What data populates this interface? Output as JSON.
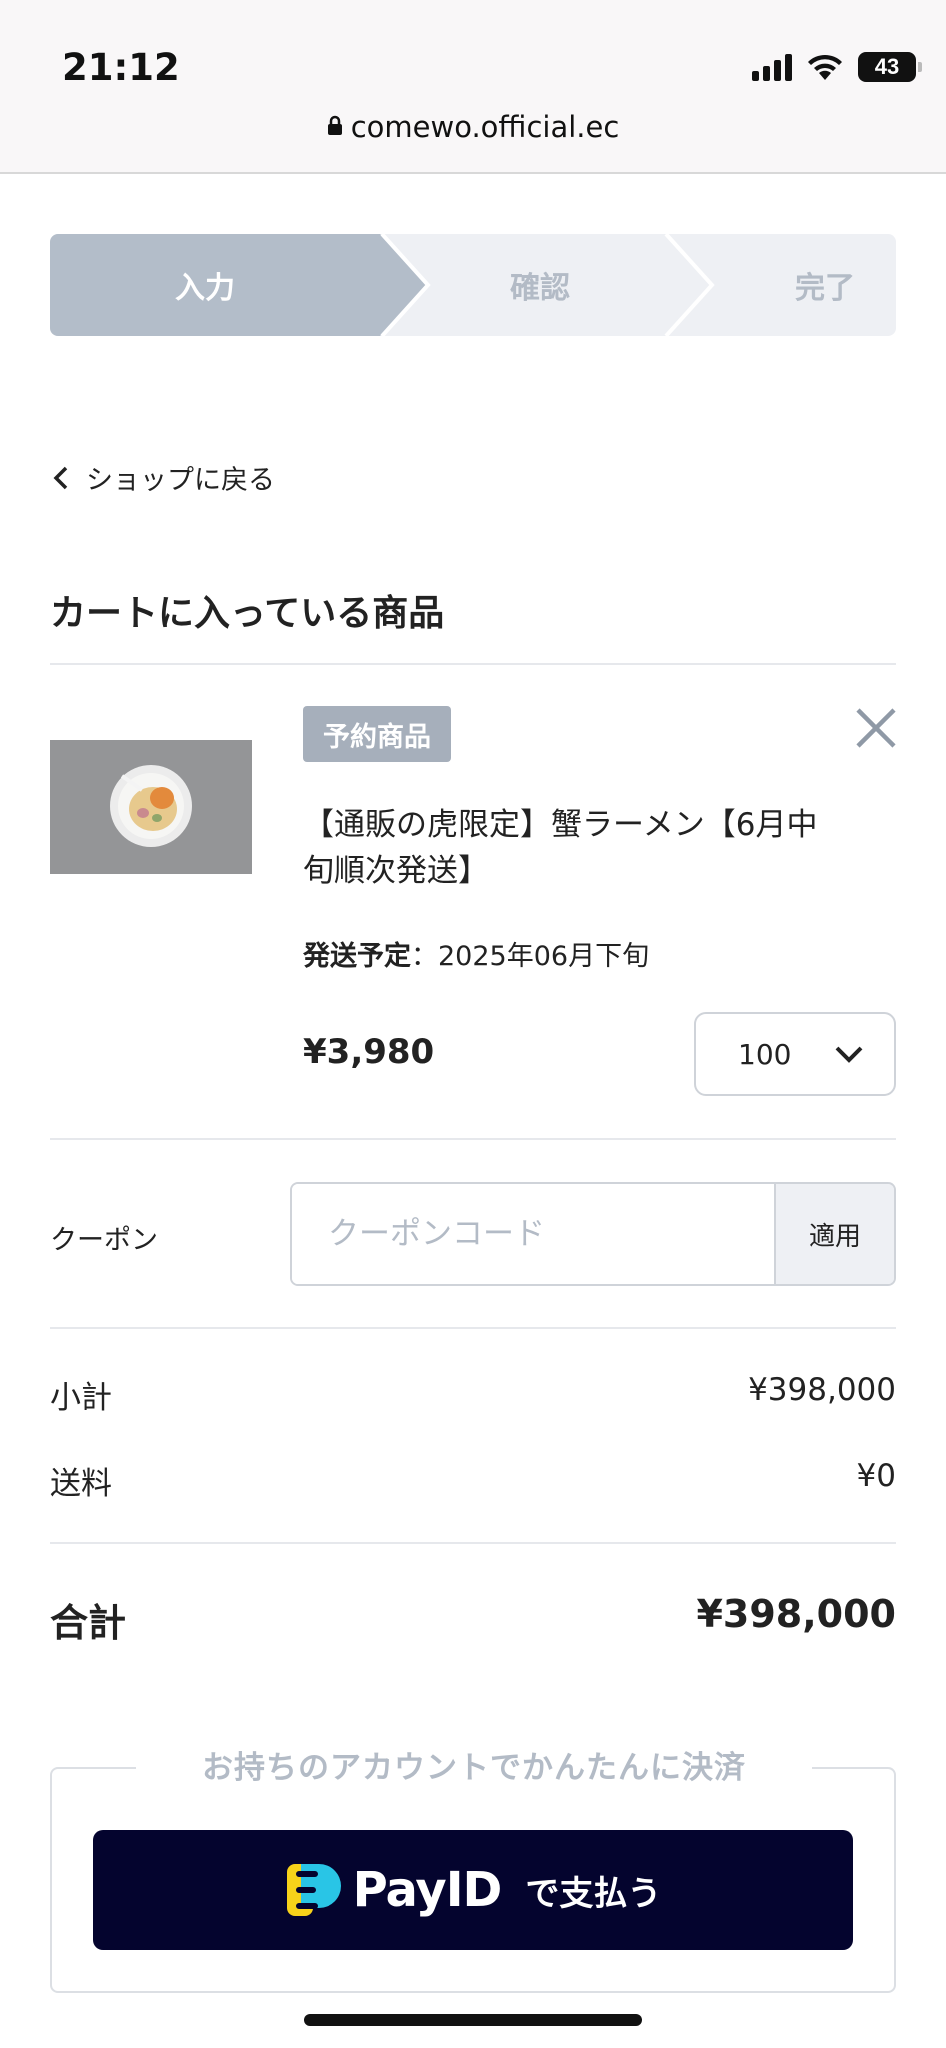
{
  "status_bar": {
    "time": "21:12",
    "battery": "43"
  },
  "browser": {
    "url": "comewo.official.ec"
  },
  "stepper": {
    "steps": [
      "入力",
      "確認",
      "完了"
    ]
  },
  "nav": {
    "back_label": "ショップに戻る"
  },
  "cart": {
    "title": "カートに入っている商品",
    "item": {
      "badge": "予約商品",
      "name": "【通販の虎限定】蟹ラーメン【6月中旬順次発送】",
      "shipping_label": "発送予定",
      "shipping_separator": "：",
      "shipping_value": "2025年06月下旬",
      "price": "¥3,980",
      "quantity": "100"
    }
  },
  "coupon": {
    "label": "クーポン",
    "placeholder": "クーポンコード",
    "apply_label": "適用"
  },
  "summary": {
    "subtotal_label": "小計",
    "subtotal_value": "¥398,000",
    "shipping_label": "送料",
    "shipping_value": "¥0",
    "total_label": "合計",
    "total_value": "¥398,000"
  },
  "payment": {
    "caption": "お持ちのアカウントでかんたんに決済",
    "brand": "PayID",
    "button_suffix": "で支払う"
  },
  "colors": {
    "stepper_active": "#b3bdc9",
    "badge": "#a6afbb",
    "pay_button": "#04042e",
    "muted_text": "#b3bbc6"
  }
}
